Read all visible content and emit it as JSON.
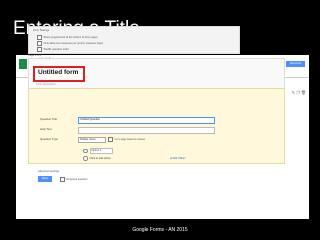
{
  "slide": {
    "title": "Entering a Title",
    "footer": "Google Forms - AN 2015"
  },
  "app": {
    "form_name": "Untitled form",
    "menu": [
      "File",
      "Edit",
      "View",
      "Insert",
      "Responses (0)",
      "Tools",
      "Add-ons",
      "Help"
    ],
    "send_label": "Send form",
    "toolbar": [
      "Edit questions",
      "Change theme",
      "View responses",
      "Summary",
      "View live form"
    ]
  },
  "settings": {
    "title": "Form Settings",
    "options": [
      "Show progress bar at the bottom of form pages",
      "Only allow one response per person (requires login)",
      "Shuffle question order"
    ]
  },
  "page_label": "Page 1 of 1",
  "form": {
    "title": "Untitled form",
    "description_placeholder": "Form Description"
  },
  "question": {
    "title_label": "Question Title",
    "title_value": "Untitled Question",
    "help_label": "Help Text",
    "type_label": "Question Type",
    "type_value": "Multiple choice",
    "goto_label": "Go to page based on answer",
    "option1": "Option 1",
    "option2_placeholder": "Click to add option",
    "add_other": "or Add \"Other\"",
    "advanced": "Advanced settings",
    "done_label": "Done",
    "required_label": "Required question"
  },
  "colors": {
    "highlight": "#e02020",
    "accent": "#4d90fe"
  }
}
